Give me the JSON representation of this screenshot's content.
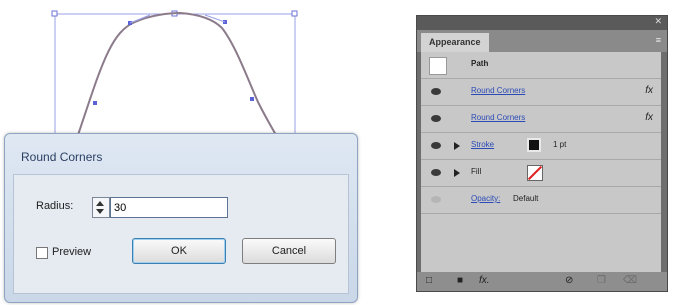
{
  "round_corners_dialog": {
    "title": "Round Corners",
    "radius_label": "Radius:",
    "radius_value": "30",
    "preview_label": "Preview",
    "preview_checked": false,
    "ok_label": "OK",
    "cancel_label": "Cancel"
  },
  "appearance_panel": {
    "tab_label": "Appearance",
    "close_glyph": "✕",
    "menu_glyph": "≡",
    "path_label": "Path",
    "effects": [
      {
        "label": "Round Corners",
        "fx_icon": "fx-icon"
      },
      {
        "label": "Round Corners",
        "fx_icon": "fx-icon"
      }
    ],
    "stroke": {
      "label": "Stroke",
      "weight": "1 pt",
      "color": "#000000"
    },
    "fill": {
      "label": "Fill",
      "color": "none"
    },
    "opacity": {
      "label": "Opacity:",
      "value": "Default"
    },
    "fx_glyph": "fx",
    "bottom_icons": [
      "new-stroke-icon",
      "new-fill-icon",
      "add-effect-icon",
      "clear-icon",
      "duplicate-icon",
      "delete-icon"
    ],
    "bottom_glyphs": [
      "□",
      "■",
      "fx.",
      "⊘",
      "❐",
      "⌫"
    ]
  }
}
